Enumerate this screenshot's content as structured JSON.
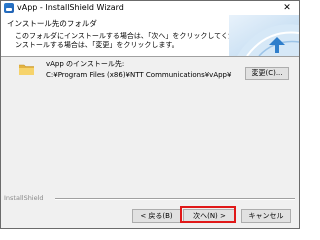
{
  "window": {
    "title": "vApp - InstallShield Wizard",
    "close_glyph": "✕",
    "icon": "app-icon"
  },
  "banner": {
    "title": "インストール先のフォルダ",
    "description_lines": [
      "このフォルダにインストールする場合は、「次へ」をクリックしてください。別のフォルダにイ",
      "ンストールする場合は、「変更」をクリックします。"
    ]
  },
  "destination": {
    "icon": "folder-icon",
    "label": "vApp のインストール先:",
    "path": "C:¥Program Files (x86)¥NTT Communications¥vApp¥",
    "change_label": "変更(C)..."
  },
  "footer": {
    "brand_label": "InstallShield",
    "back_label": "< 戻る(B)",
    "next_label": "次へ(N) >",
    "cancel_label": "キャンセル"
  },
  "colors": {
    "highlight": "#e01818",
    "banner_accent": "#2f7ecb"
  }
}
